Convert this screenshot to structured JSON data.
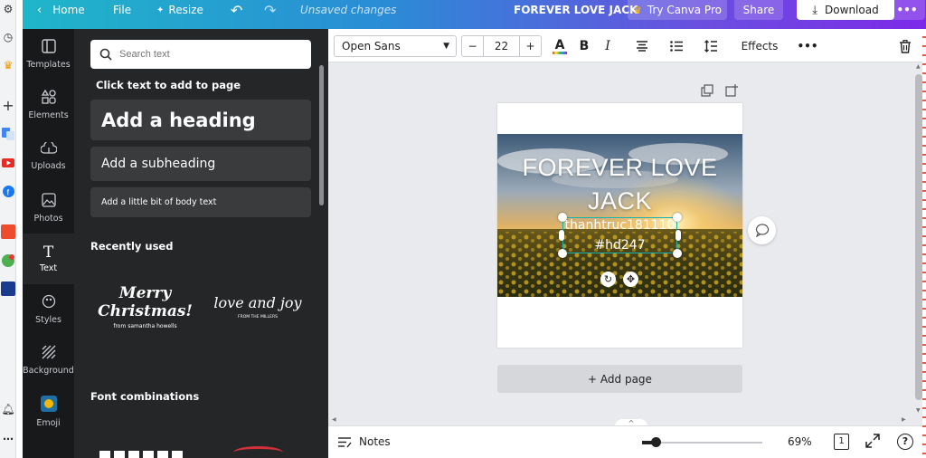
{
  "topbar": {
    "home": "Home",
    "file": "File",
    "resize": "Resize",
    "status": "Unsaved changes",
    "title": "FOREVER LOVE JACK",
    "try_pro": "Try Canva Pro",
    "share": "Share",
    "download": "Download"
  },
  "rail": {
    "items": [
      {
        "label": "Templates",
        "icon": "templates-icon"
      },
      {
        "label": "Elements",
        "icon": "elements-icon"
      },
      {
        "label": "Uploads",
        "icon": "uploads-icon"
      },
      {
        "label": "Photos",
        "icon": "photos-icon"
      },
      {
        "label": "Text",
        "icon": "text-icon"
      },
      {
        "label": "Styles",
        "icon": "styles-icon"
      },
      {
        "label": "Background",
        "icon": "background-icon"
      },
      {
        "label": "Emoji",
        "icon": "emoji-icon"
      }
    ]
  },
  "panel": {
    "search_placeholder": "Search text",
    "click_hint": "Click text to add to page",
    "heading": "Add a heading",
    "subheading": "Add a subheading",
    "body": "Add a little bit of body text",
    "recently_used": "Recently used",
    "font_combinations": "Font combinations",
    "sample1_line1": "Merry",
    "sample1_line2": "Christmas!",
    "sample1_sub": "from samantha howells",
    "sample2_main": "love and joy",
    "sample2_sub": "FROM THE MILLERS"
  },
  "toolbar": {
    "font": "Open Sans",
    "size": "22",
    "minus": "−",
    "plus": "+",
    "effects": "Effects"
  },
  "canvas": {
    "title_line1": "FOREVER LOVE",
    "title_line2": "JACK",
    "caption_line1": "thanhtruc181110",
    "caption_line2": "#hd247",
    "add_page": "+ Add page"
  },
  "bottombar": {
    "notes": "Notes",
    "zoom": "69%",
    "page_count": "1",
    "zoom_level": 0.11
  },
  "colors": {
    "accent_teal": "#1fb6c9",
    "accent_purple": "#7d2ae8",
    "selection": "#16b3b0",
    "panel_dark": "#252627"
  }
}
